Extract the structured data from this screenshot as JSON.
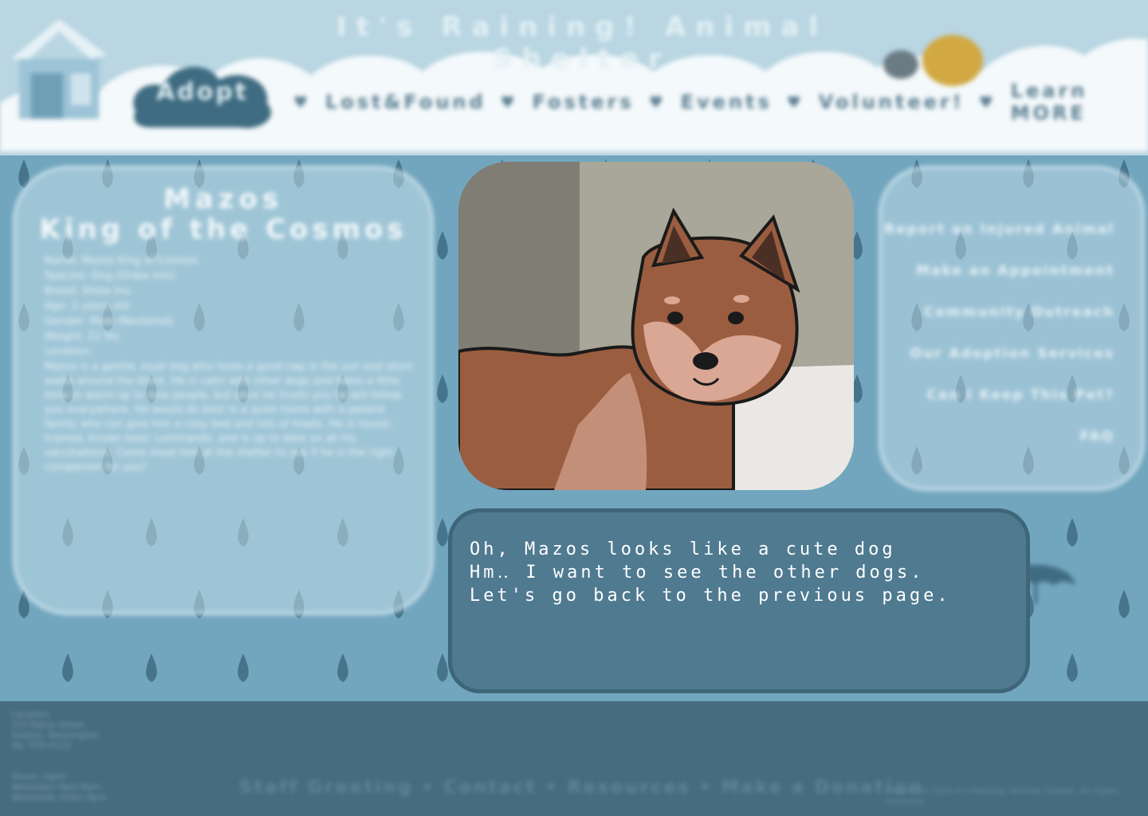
{
  "site": {
    "title": "It's Raining! Animal Shelter"
  },
  "nav": {
    "adopt_label": "Adopt",
    "items": [
      {
        "label": "Lost&Found"
      },
      {
        "label": "Fosters"
      },
      {
        "label": "Events"
      },
      {
        "label": "Volunteer!"
      },
      {
        "label": "Learn MORE"
      }
    ]
  },
  "pet": {
    "name": "Mazos",
    "title": "King of the Cosmos",
    "facts": [
      "Name: Mazos King of Cosmos",
      "Species: Dog (Shiba mix)",
      "Breed: Shiba Inu",
      "Age: 2 years old",
      "Gender: Male (Neutered)",
      "Weight: 22 lbs",
      "Location:"
    ],
    "description": "Mazos is a gentle, loyal dog who loves a good nap in the sun and short walks around the block. He is calm with other dogs and takes a little time to warm up to new people, but once he trusts you he will follow you everywhere. He would do best in a quiet home with a patient family who can give him a cozy bed and lots of treats. He is house-trained, knows basic commands, and is up to date on all his vaccinations. Come meet him at the shelter to see if he is the right companion for you!"
  },
  "side_menu": {
    "items": [
      {
        "label": "Report an Injured Animal"
      },
      {
        "label": "Make an Appointment"
      },
      {
        "label": "Community Outreach"
      },
      {
        "label": "Our Adoption Services"
      },
      {
        "label": "Can I Keep This Pet?"
      },
      {
        "label": "FAQ"
      }
    ]
  },
  "dialog": {
    "lines": [
      "Oh, Mazos looks like a cute dog",
      "Hm‥ I want to see the other dogs.",
      "Let's go back to the previous page."
    ]
  },
  "footer": {
    "address_lines": [
      "Location:",
      "123 Rainy Street",
      "Seattle, Washington",
      "Tel: 555-0123"
    ],
    "hours_lines": [
      "Hours: Open",
      "Weekdays 9am-6pm",
      "Weekends 10am-4pm"
    ],
    "links": "Staff Greeting • Contact • Resources • Make a Donation",
    "copyright": "Copyright 2023 It's Raining! Animal Shelter. All rights reserved."
  },
  "colors": {
    "sky": "#b9d6e2",
    "rain_background": "#72a6bf",
    "raindrop": "#3f6c82",
    "footer": "#466c7f",
    "dialog": "#4f7a90",
    "dog_fur": "#9b5d40"
  },
  "icons": {
    "house": "dog-house-icon",
    "pets": "cat-and-dog-icon",
    "umbrella": "umbrella-icon",
    "nav_separator": "heart-icon"
  }
}
